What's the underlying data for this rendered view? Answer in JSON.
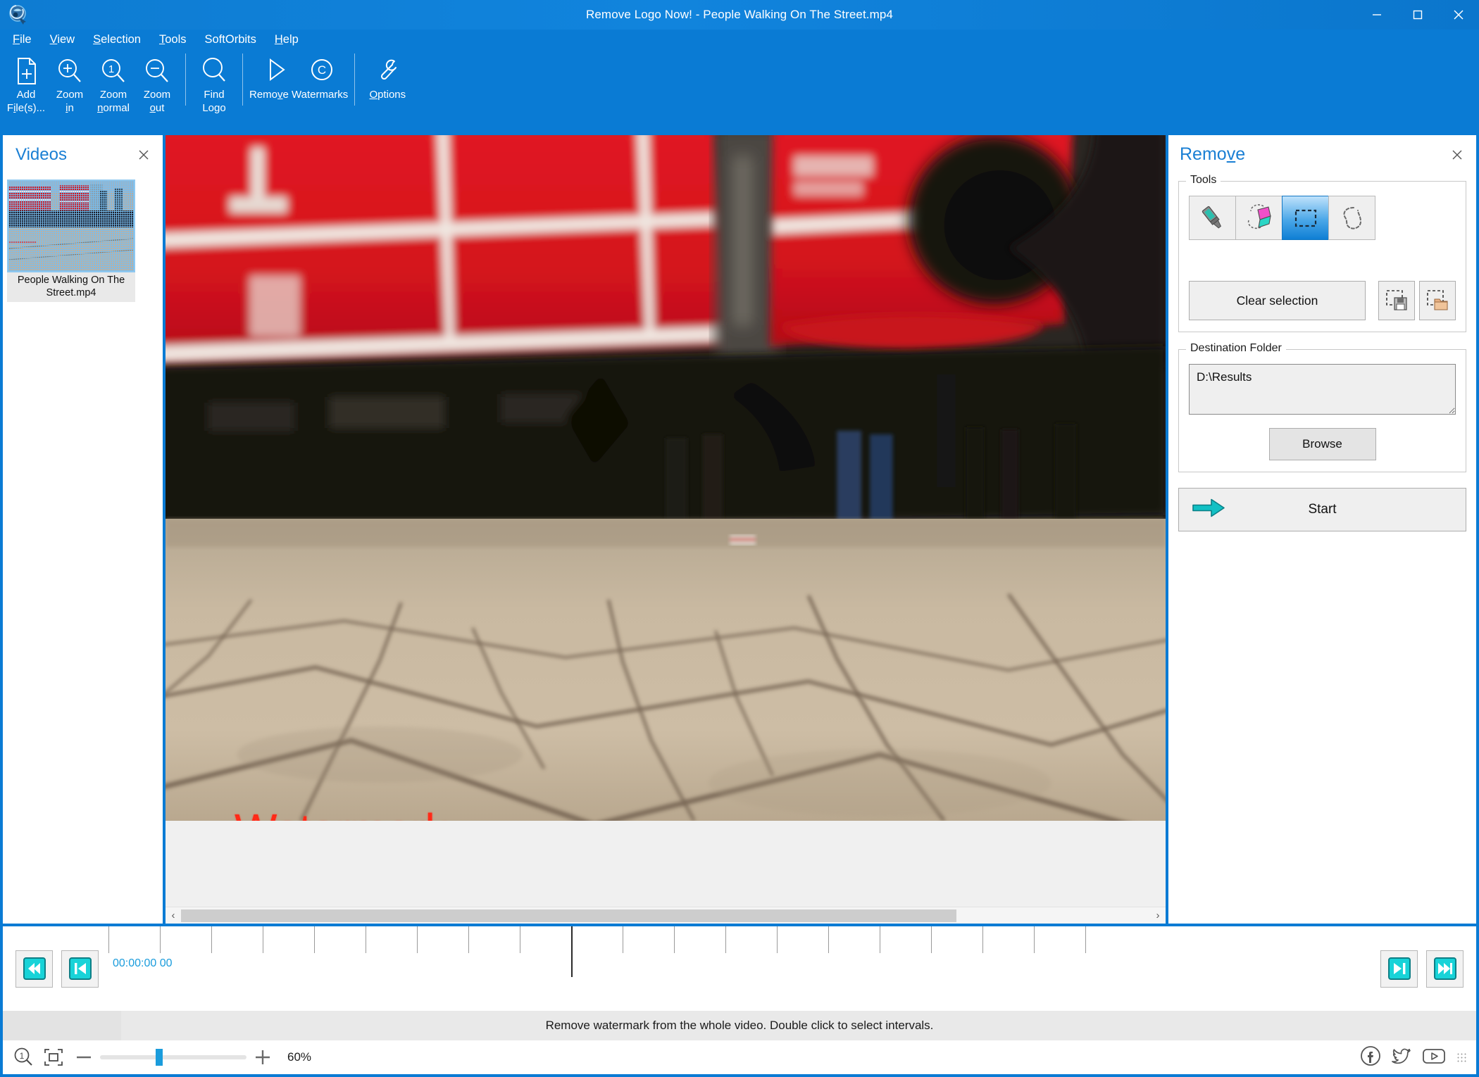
{
  "window": {
    "title": "Remove Logo Now! - People Walking On The Street.mp4",
    "minimize": "–",
    "maximize": "□",
    "close": "✕",
    "accent_color": "#0a7bd4",
    "link_color": "#1a7fd4"
  },
  "menu": [
    {
      "pre": "",
      "key": "F",
      "post": "ile"
    },
    {
      "pre": "",
      "key": "V",
      "post": "iew"
    },
    {
      "pre": "",
      "key": "S",
      "post": "election"
    },
    {
      "pre": "",
      "key": "T",
      "post": "ools"
    },
    {
      "pre": "SoftOrbits",
      "key": "",
      "post": ""
    },
    {
      "pre": "",
      "key": "H",
      "post": "elp"
    }
  ],
  "toolbar": {
    "add_files_l1": "Add",
    "add_files_l2": "File(s)...",
    "zoom_in_l1": "Zoom",
    "zoom_in_l2": "in",
    "zoom_normal_l1": "Zoom",
    "zoom_normal_l2": "normal",
    "zoom_out_l1": "Zoom",
    "zoom_out_l2": "out",
    "find_logo_l1": "Find",
    "find_logo_l2": "Logo",
    "remove_label": "Remove",
    "watermarks_label": "Watermarks",
    "options_label": "Options",
    "zoom_normal_badge": "1"
  },
  "videos_panel": {
    "title": "Videos",
    "close": "✕",
    "items": [
      {
        "caption": "People Walking On The Street.mp4",
        "selected": true
      }
    ]
  },
  "canvas": {
    "watermark_text": "Watermark",
    "watermark_color": "#ff2a18",
    "scroll_left_arrow": "‹",
    "scroll_right_arrow": "›"
  },
  "remove_panel": {
    "title_pre": "Remo",
    "title_key": "v",
    "title_post": "e",
    "close": "✕",
    "tools_group_label": "Tools",
    "tools": [
      {
        "name": "marker-tool",
        "selected": false
      },
      {
        "name": "eraser-tool",
        "selected": false
      },
      {
        "name": "rectangle-select-tool",
        "selected": true
      },
      {
        "name": "lasso-select-tool",
        "selected": false
      }
    ],
    "clear_selection_label": "Clear selection",
    "save_selection_name": "save-selection",
    "load_selection_name": "load-selection",
    "destination_group_label": "Destination Folder",
    "destination_value": "D:\\Results",
    "destination_placeholder": "Destination folder",
    "browse_label": "Browse",
    "start_label": "Start"
  },
  "timeline": {
    "timecode": "00:00:00 00",
    "first_frame_label": "⏮",
    "prev_frame_label": "◀",
    "next_frame_label": "▶",
    "last_frame_label": "⏭"
  },
  "statusbar": {
    "text": "Remove watermark from the whole video. Double click to select intervals."
  },
  "zoombar": {
    "minus": "–",
    "plus": "+",
    "percent": "60%",
    "zoom_value": 60
  }
}
